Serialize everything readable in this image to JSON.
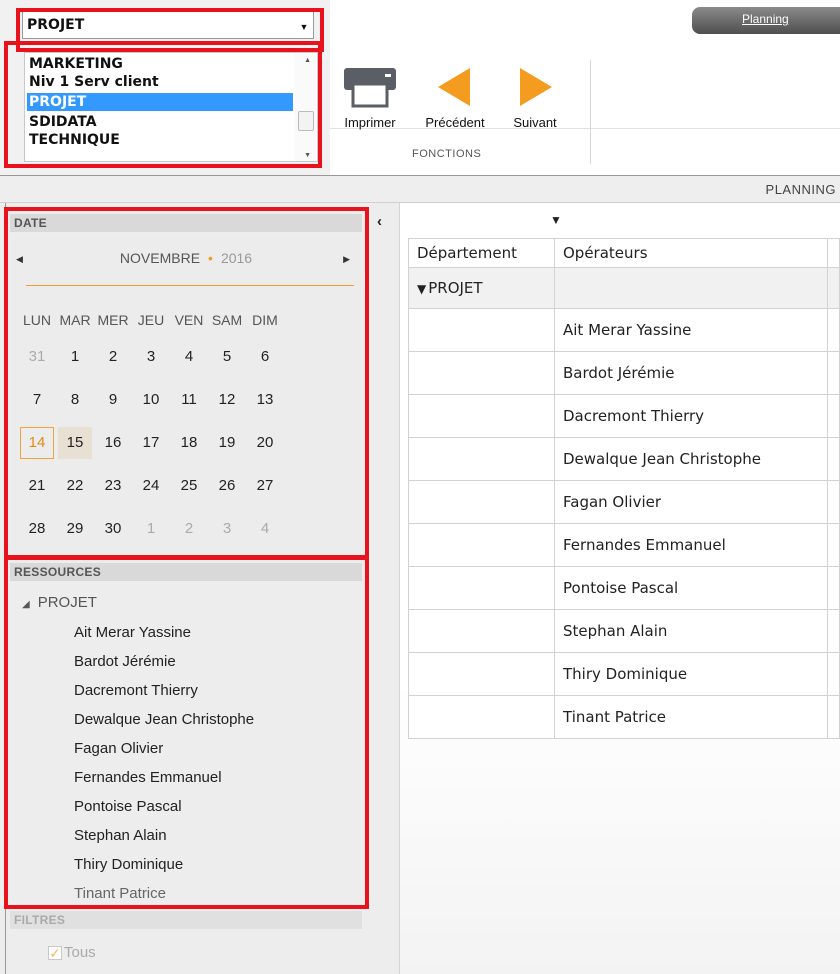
{
  "header": {
    "planning_tab": "Planning",
    "department_select": {
      "value": "PROJET",
      "options": [
        "MARKETING",
        "Niv 1 Serv client",
        "PROJET",
        "SDIDATA",
        "TECHNIQUE"
      ],
      "selected_index": 2
    },
    "functions": {
      "print": "Imprimer",
      "previous": "Précédent",
      "next": "Suivant",
      "group_label": "FONCTIONS"
    }
  },
  "planning_strip": {
    "title": "PLANNING"
  },
  "date_panel": {
    "header": "DATE",
    "month": "NOVEMBRE",
    "year": "2016",
    "weekdays": [
      "LUN",
      "MAR",
      "MER",
      "JEU",
      "VEN",
      "SAM",
      "DIM"
    ],
    "weeks": [
      [
        "31",
        "1",
        "2",
        "3",
        "4",
        "5",
        "6"
      ],
      [
        "7",
        "8",
        "9",
        "10",
        "11",
        "12",
        "13"
      ],
      [
        "14",
        "15",
        "16",
        "17",
        "18",
        "19",
        "20"
      ],
      [
        "21",
        "22",
        "23",
        "24",
        "25",
        "26",
        "27"
      ],
      [
        "28",
        "29",
        "30",
        "1",
        "2",
        "3",
        "4"
      ]
    ],
    "today": "14",
    "selected": "15"
  },
  "resources_panel": {
    "header": "RESSOURCES",
    "root": "PROJET",
    "items": [
      "Ait Merar Yassine",
      "Bardot Jérémie",
      "Dacremont Thierry",
      "Dewalque Jean Christophe",
      "Fagan Olivier",
      "Fernandes Emmanuel",
      "Pontoise Pascal",
      "Stephan Alain",
      "Thiry Dominique",
      "Tinant Patrice"
    ]
  },
  "filters_panel": {
    "header": "FILTRES",
    "all_label": "Tous"
  },
  "grid": {
    "columns": [
      "Département",
      "Opérateurs"
    ],
    "group": "PROJET",
    "operators": [
      "Ait Merar Yassine",
      "Bardot Jérémie",
      "Dacremont Thierry",
      "Dewalque Jean Christophe",
      "Fagan Olivier",
      "Fernandes Emmanuel",
      "Pontoise Pascal",
      "Stephan Alain",
      "Thiry Dominique",
      "Tinant Patrice"
    ]
  },
  "colors": {
    "highlight_red": "#e8121c",
    "accent_orange": "#f39c1f",
    "selection_blue": "#3399ff"
  }
}
